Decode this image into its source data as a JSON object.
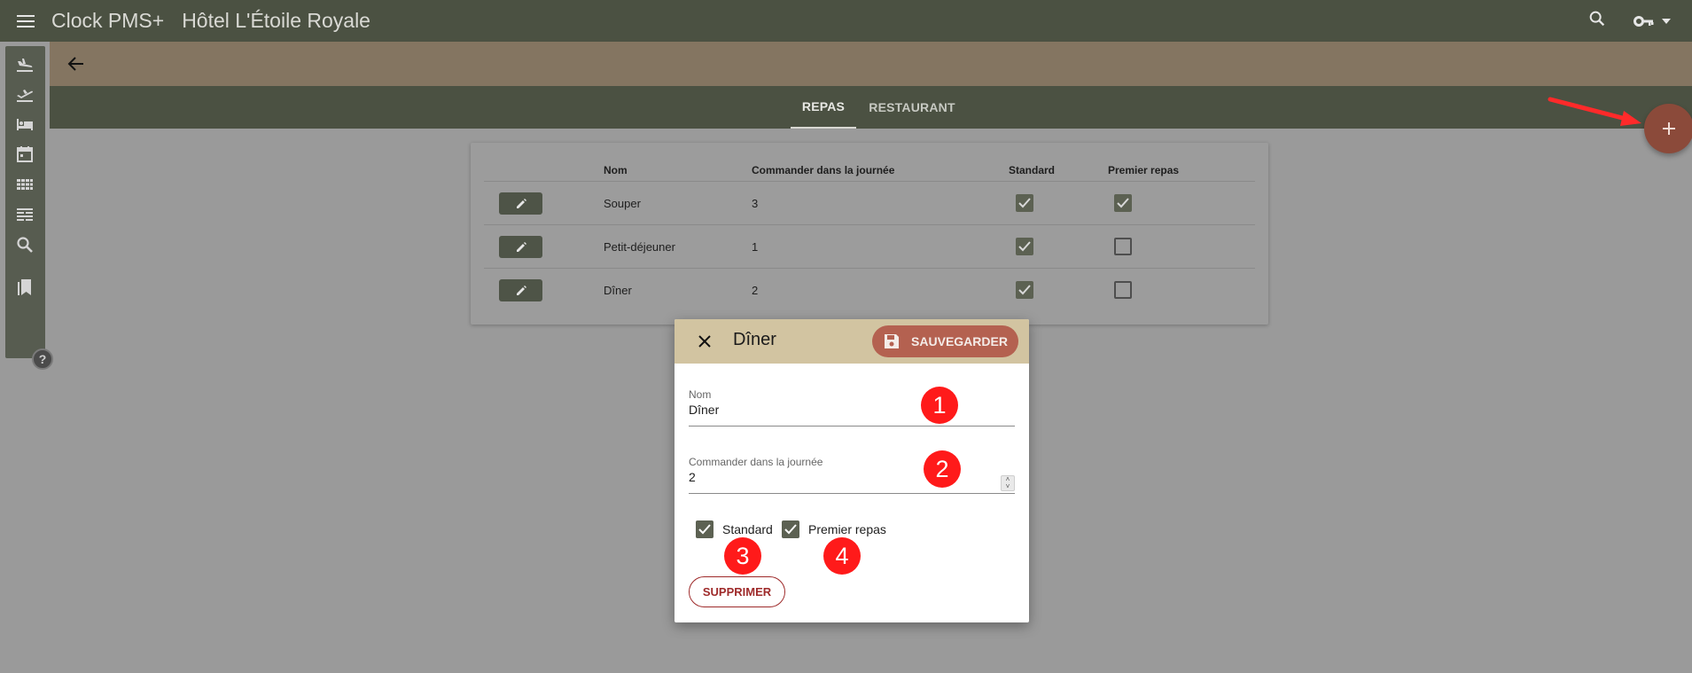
{
  "app": {
    "product": "Clock PMS+",
    "hotel": "Hôtel L'Étoile Royale"
  },
  "tabs": [
    {
      "label": "REPAS",
      "active": true
    },
    {
      "label": "RESTAURANT",
      "active": false
    }
  ],
  "table": {
    "headers": {
      "name": "Nom",
      "order_day": "Commander dans la journée",
      "standard": "Standard",
      "premier": "Premier repas"
    },
    "rows": [
      {
        "name": "Souper",
        "order_day": "3",
        "standard": true,
        "premier": true
      },
      {
        "name": "Petit-déjeuner",
        "order_day": "1",
        "standard": true,
        "premier": false
      },
      {
        "name": "Dîner",
        "order_day": "2",
        "standard": true,
        "premier": false
      }
    ]
  },
  "dialog": {
    "title": "Dîner",
    "save_label": "SAUVEGARDER",
    "name_label": "Nom",
    "name_value": "Dîner",
    "order_label": "Commander dans la journée",
    "order_value": "2",
    "standard_label": "Standard",
    "standard_checked": true,
    "premier_label": "Premier repas",
    "premier_checked": true,
    "delete_label": "SUPPRIMER"
  },
  "annotations": [
    "1",
    "2",
    "3",
    "4"
  ],
  "help_icon": "?",
  "colors": {
    "topbar": "#4b5142",
    "tan_bar": "#847561",
    "dialog_header": "#d2c4a1",
    "save_button": "#b46150",
    "fab": "#8b4a3a",
    "annotation": "#ff1a1a"
  },
  "icons": [
    "menu-icon",
    "search-icon",
    "key-icon",
    "arrow-back-icon",
    "plus-icon",
    "edit-icon",
    "close-icon",
    "save-icon",
    "flight-land-icon",
    "flight-takeoff-icon",
    "bed-icon",
    "calendar-icon",
    "grid-icon",
    "list-icon",
    "bookmarks-icon",
    "help-icon"
  ]
}
